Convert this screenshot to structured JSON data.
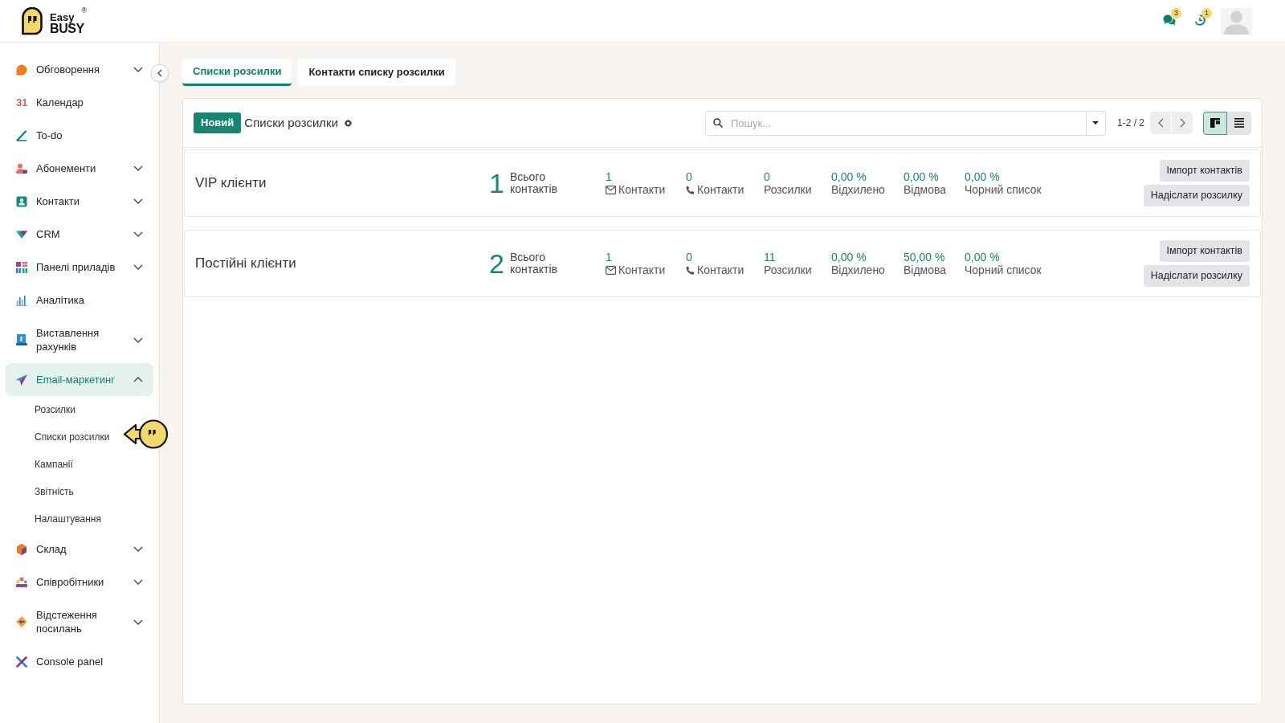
{
  "header": {
    "logo": {
      "word_1": "Easy",
      "word_2": "BUSY",
      "registered_mark": "®"
    },
    "indicators": [
      {
        "kind": "messages",
        "count": "3"
      },
      {
        "kind": "activities",
        "count": "1"
      }
    ]
  },
  "sidebar": {
    "items": [
      {
        "label": "Обговорення",
        "kind": "group",
        "expanded": false,
        "selected": false
      },
      {
        "label": "Календар",
        "kind": "link",
        "selected": false,
        "icon_text": "31"
      },
      {
        "label": "To-do",
        "kind": "link",
        "selected": false
      },
      {
        "label": "Абонементи",
        "kind": "group",
        "expanded": false,
        "selected": false
      },
      {
        "label": "Контакти",
        "kind": "group",
        "expanded": false,
        "selected": false
      },
      {
        "label": "CRM",
        "kind": "group",
        "expanded": false,
        "selected": false
      },
      {
        "label": "Панелі приладів",
        "kind": "group",
        "expanded": false,
        "selected": false
      },
      {
        "label": "Аналітика",
        "kind": "link",
        "selected": false
      },
      {
        "label": "Виставлення рахунків",
        "kind": "group",
        "expanded": false,
        "selected": false
      },
      {
        "label": "Email-маркетинг",
        "kind": "group",
        "expanded": true,
        "selected": true,
        "children": [
          {
            "label": "Розсилки"
          },
          {
            "label": "Списки розсилки"
          },
          {
            "label": "Кампанії"
          },
          {
            "label": "Звітність"
          },
          {
            "label": "Налаштування"
          }
        ]
      },
      {
        "label": "Склад",
        "kind": "group",
        "expanded": false,
        "selected": false
      },
      {
        "label": "Співробітники",
        "kind": "group",
        "expanded": false,
        "selected": false
      },
      {
        "label": "Відстеження посилань",
        "kind": "group",
        "expanded": false,
        "selected": false
      },
      {
        "label": "Console panel",
        "kind": "link",
        "selected": false
      }
    ]
  },
  "tabs": [
    {
      "label": "Списки розсилки",
      "selected": true
    },
    {
      "label": "Контакти списку розсилки",
      "selected": false
    }
  ],
  "toolbar": {
    "new_button": "Новий",
    "title": "Списки розсилки",
    "search": {
      "placeholder": "Пошук..."
    },
    "pager": "1-2 / 2",
    "views": [
      {
        "kind": "kanban",
        "selected": true
      },
      {
        "kind": "list",
        "selected": false
      }
    ]
  },
  "mailing_lists": [
    {
      "name": "VIP клієнти",
      "total": "1",
      "total_label": "Всього контактів",
      "stats": [
        {
          "kind": "email",
          "value": "1",
          "label": "Контакти"
        },
        {
          "kind": "phone",
          "value": "0",
          "label": "Контакти"
        },
        {
          "kind": "plain",
          "value": "0",
          "label": "Розсилки"
        },
        {
          "kind": "plain",
          "value": "0,00 %",
          "label": "Відхилено"
        },
        {
          "kind": "plain",
          "value": "0,00 %",
          "label": "Відмова"
        },
        {
          "kind": "plain",
          "value": "0,00 %",
          "label": "Чорний список"
        }
      ],
      "actions": [
        "Імпорт контактів",
        "Надіслати розсилку"
      ]
    },
    {
      "name": "Постійні клієнти",
      "total": "2",
      "total_label": "Всього контактів",
      "stats": [
        {
          "kind": "email",
          "value": "1",
          "label": "Контакти"
        },
        {
          "kind": "phone",
          "value": "0",
          "label": "Контакти"
        },
        {
          "kind": "plain",
          "value": "11",
          "label": "Розсилки"
        },
        {
          "kind": "plain",
          "value": "0,00 %",
          "label": "Відхилено"
        },
        {
          "kind": "plain",
          "value": "50,00 %",
          "label": "Відмова"
        },
        {
          "kind": "plain",
          "value": "0,00 %",
          "label": "Чорний список"
        }
      ],
      "actions": [
        "Імпорт контактів",
        "Надіслати розсилку"
      ]
    }
  ]
}
